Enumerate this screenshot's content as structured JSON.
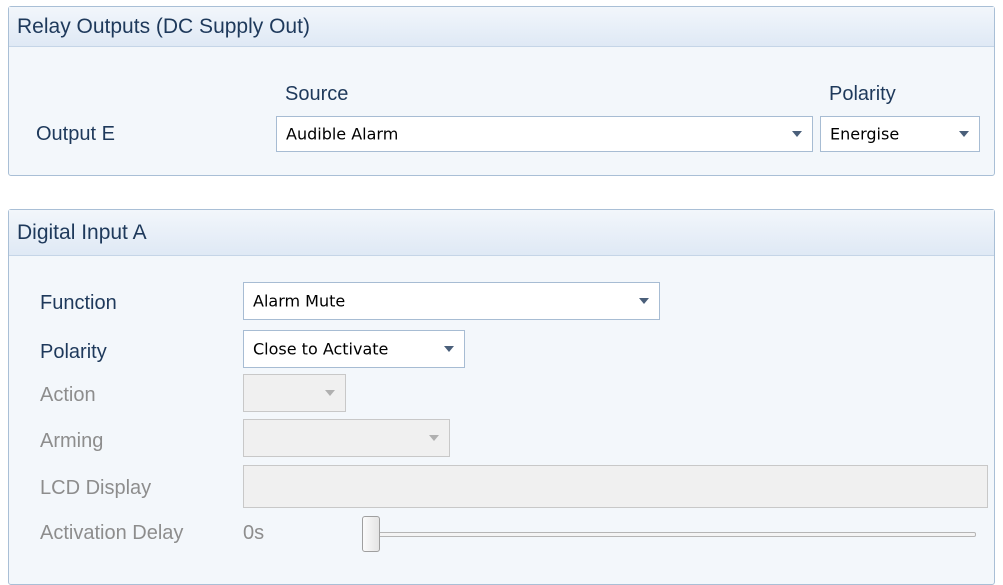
{
  "relay_panel": {
    "title": "Relay Outputs (DC Supply Out)",
    "source_header": "Source",
    "polarity_header": "Polarity",
    "output_label": "Output E",
    "source_value": "Audible Alarm",
    "polarity_value": "Energise"
  },
  "digital_input_panel": {
    "title": "Digital Input A",
    "function_label": "Function",
    "function_value": "Alarm Mute",
    "polarity_label": "Polarity",
    "polarity_value": "Close to Activate",
    "action_label": "Action",
    "action_value": "",
    "arming_label": "Arming",
    "arming_value": "",
    "lcd_display_label": "LCD Display",
    "lcd_display_value": "",
    "activation_delay_label": "Activation Delay",
    "activation_delay_value": "0s",
    "activation_delay_slider_fraction": 0
  },
  "colors": {
    "label_text": "#1e395b",
    "disabled_text": "#8d8d8d",
    "panel_border": "#a9bfd6",
    "panel_background": "#f3f7fb"
  },
  "icons": {
    "dropdown": "chevron-down-icon"
  }
}
